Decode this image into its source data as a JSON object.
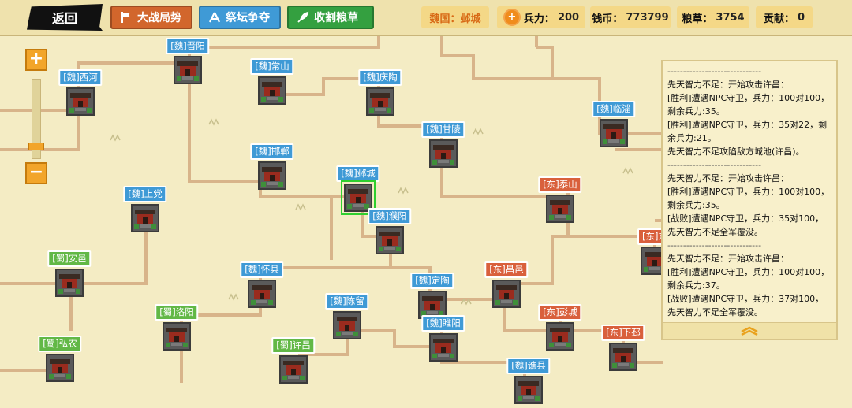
{
  "topbar": {
    "back_label": "返回",
    "buttons": [
      {
        "label": "大战局势",
        "color": "#d2662c",
        "icon": "flag-icon"
      },
      {
        "label": "祭坛争夺",
        "color": "#3f9ad6",
        "icon": "altar-icon"
      },
      {
        "label": "收割粮草",
        "color": "#34a040",
        "icon": "feather-icon"
      }
    ],
    "nation": "魏国：邺城",
    "troops_label": "兵力：",
    "troops_value": "200",
    "coins_label": "钱币：",
    "coins_value": "773799",
    "grain_label": "粮草：",
    "grain_value": "3754",
    "contrib_label": "贡献：",
    "contrib_value": "0"
  },
  "colors": {
    "wei": "#3f9ad6",
    "shu": "#62b846",
    "dong": "#d9603c",
    "road": "#d8b48a"
  },
  "cities": [
    {
      "id": "jinyang",
      "label": "[魏]晋阳",
      "faction": "wei"
    },
    {
      "id": "xihe",
      "label": "[魏]西河",
      "faction": "wei"
    },
    {
      "id": "changshan",
      "label": "[魏]常山",
      "faction": "wei"
    },
    {
      "id": "qingtao",
      "label": "[魏]庆陶",
      "faction": "wei"
    },
    {
      "id": "linzi",
      "label": "[魏]临淄",
      "faction": "wei"
    },
    {
      "id": "ganling",
      "label": "[魏]甘陵",
      "faction": "wei"
    },
    {
      "id": "handan",
      "label": "[魏]邯郸",
      "faction": "wei"
    },
    {
      "id": "yecheng",
      "label": "[魏]邺城",
      "faction": "wei",
      "selected": true
    },
    {
      "id": "shangdang",
      "label": "[魏]上党",
      "faction": "wei"
    },
    {
      "id": "puyang",
      "label": "[魏]濮阳",
      "faction": "wei"
    },
    {
      "id": "taishan",
      "label": "[东]泰山",
      "faction": "dong"
    },
    {
      "id": "anyi",
      "label": "[蜀]安邑",
      "faction": "shu"
    },
    {
      "id": "huaixian",
      "label": "[魏]怀县",
      "faction": "wei"
    },
    {
      "id": "dingtao",
      "label": "[魏]定陶",
      "faction": "wei"
    },
    {
      "id": "changyi",
      "label": "[东]昌邑",
      "faction": "dong"
    },
    {
      "id": "chenliu",
      "label": "[魏]陈留",
      "faction": "wei"
    },
    {
      "id": "luoyang",
      "label": "[蜀]洛阳",
      "faction": "shu"
    },
    {
      "id": "pengcheng",
      "label": "[东]彭城",
      "faction": "dong"
    },
    {
      "id": "suiyang",
      "label": "[魏]睢阳",
      "faction": "wei"
    },
    {
      "id": "hongnong",
      "label": "[蜀]弘农",
      "faction": "shu"
    },
    {
      "id": "xuchang",
      "label": "[蜀]许昌",
      "faction": "shu"
    },
    {
      "id": "xiapi",
      "label": "[东]下邳",
      "faction": "dong"
    },
    {
      "id": "qiaoxian",
      "label": "[魏]谯县",
      "faction": "wei"
    },
    {
      "id": "dongedge",
      "label": "[东]东",
      "faction": "dong"
    }
  ],
  "log": {
    "separator": "------------------------------",
    "entries": [
      {
        "lines": [
          "先天智力不足：开始攻击许昌：",
          "[胜利]遭遇NPC守卫，兵力：100对100，剩余兵力:35。",
          "[胜利]遭遇NPC守卫，兵力：35对22，剩余兵力:21。",
          "先天智力不足攻陷敌方城池(许昌)。"
        ]
      },
      {
        "lines": [
          "先天智力不足：开始攻击许昌：",
          "[胜利]遭遇NPC守卫，兵力：100对100，剩余兵力:35。",
          "[战败]遭遇NPC守卫，兵力：35对100，先天智力不足全军覆没。"
        ]
      },
      {
        "lines": [
          "先天智力不足：开始攻击许昌：",
          "[胜利]遭遇NPC守卫，兵力：100对100，剩余兵力:37。",
          "[战败]遭遇NPC守卫，兵力：37对100，先天智力不足全军覆没。"
        ]
      }
    ]
  },
  "zoom": {
    "level": 0.88
  }
}
